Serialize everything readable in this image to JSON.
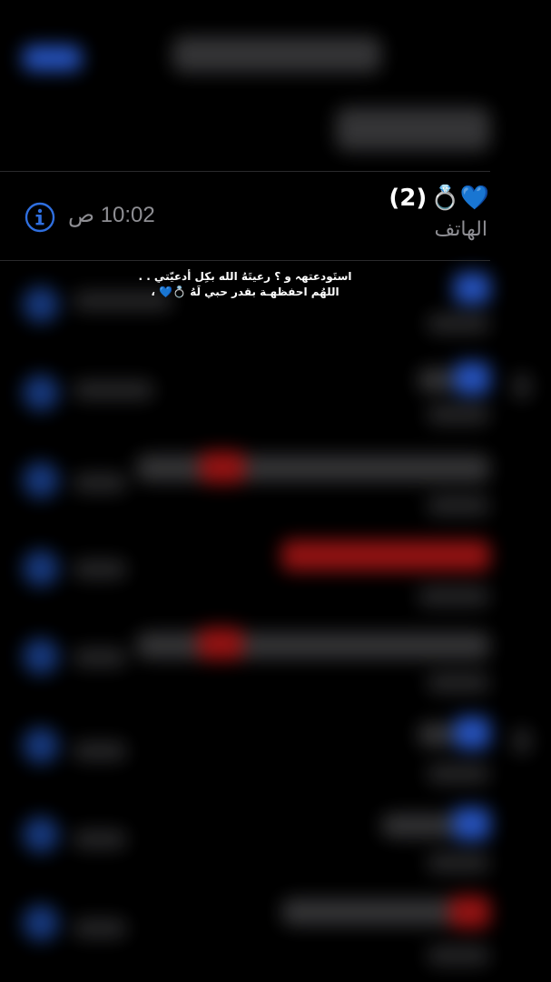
{
  "call_entry": {
    "name": "(2)",
    "name_emojis": "💙💍",
    "type": "الهاتف",
    "time": "10:02 ص",
    "info_icon": "info-icon"
  },
  "caption": {
    "line1": "استَودعتهہ و ؟ رعيتَهُ الله بكِل أدعيّتي . .",
    "line2": "اللهُم احفظهـة بقدر حبي لَهُ 💍💙 ،"
  },
  "colors": {
    "background": "#000000",
    "accent": "#2f6fdf",
    "secondary_text": "#8e8e93",
    "missed": "#a31515"
  }
}
